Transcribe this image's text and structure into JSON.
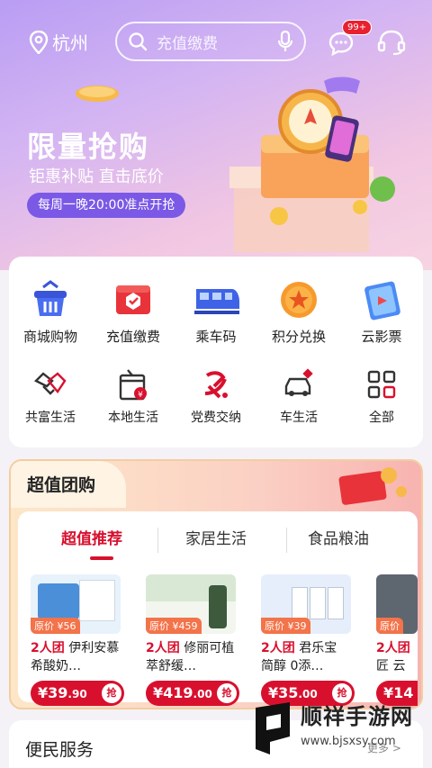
{
  "header": {
    "city": "杭州",
    "search_placeholder": "充值缴费",
    "message_badge": "99+"
  },
  "promo": {
    "title": "限量抢购",
    "subtitle": "钜惠补贴 直击底价",
    "pill": "每周一晚20:00准点开抢"
  },
  "services": [
    {
      "label": "商城购物",
      "icon": "shopping-basket-icon"
    },
    {
      "label": "充值缴费",
      "icon": "recharge-icon"
    },
    {
      "label": "乘车码",
      "icon": "train-icon"
    },
    {
      "label": "积分兑换",
      "icon": "star-coin-icon"
    },
    {
      "label": "云影票",
      "icon": "movie-ticket-icon"
    },
    {
      "label": "共富生活",
      "icon": "handshake-icon"
    },
    {
      "label": "本地生活",
      "icon": "local-shop-icon"
    },
    {
      "label": "党费交纳",
      "icon": "party-emblem-icon"
    },
    {
      "label": "车生活",
      "icon": "car-icon"
    },
    {
      "label": "全部",
      "icon": "grid-all-icon"
    }
  ],
  "group_buy": {
    "title": "超值团购",
    "tabs": [
      "超值推荐",
      "家居生活",
      "食品粮油"
    ],
    "products": [
      {
        "orig": "原价 ¥56",
        "tag": "2人团",
        "name": "伊利安慕希酸奶…",
        "price_main": "¥39",
        "price_dec": ".90",
        "grab": "抢"
      },
      {
        "orig": "原价 ¥459",
        "tag": "2人团",
        "name": "修丽可植萃舒缓…",
        "price_main": "¥419",
        "price_dec": ".00",
        "grab": "抢"
      },
      {
        "orig": "原价 ¥39",
        "tag": "2人团",
        "name": "君乐宝 简醇 0添…",
        "price_main": "¥35",
        "price_dec": ".00",
        "grab": "抢"
      },
      {
        "orig": "原价",
        "tag": "2人团",
        "name": "匠 云",
        "price_main": "¥14",
        "price_dec": "",
        "grab": ""
      }
    ]
  },
  "convenience": {
    "title": "便民服务",
    "more": "更多 >"
  },
  "watermark": {
    "name": "顺祥手游网",
    "url": "www.bjsxsy.com"
  },
  "colors": {
    "accent_red": "#d8102e",
    "promo_pill": "#7b59e6"
  }
}
